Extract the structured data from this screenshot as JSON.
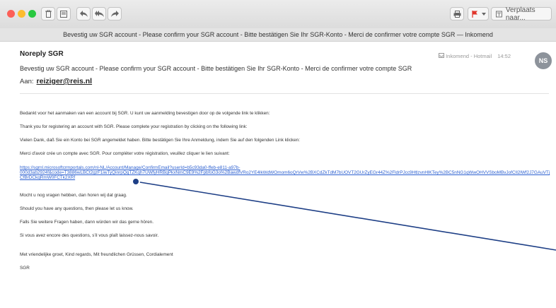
{
  "toolbar": {
    "move_label": "Verplaats naar...",
    "colors": {
      "close": "#fc5f57",
      "minimize": "#fdbc2e",
      "maximize": "#28c840",
      "flag": "#e0352b"
    }
  },
  "window_title": "Bevestig uw SGR account - Please confirm your SGR account - Bitte bestätigen Sie Ihr SGR-Konto - Merci de confirmer votre compte SGR — Inkomend",
  "message": {
    "sender": "Noreply SGR",
    "subject": "Bevestig uw SGR account - Please confirm your SGR account - Bitte bestätigen Sie Ihr SGR-Konto - Merci de confirmer votre compte SGR",
    "to_label": "Aan:",
    "to_address": "reiziger@reis.nl",
    "mailbox": "Inkomend - Hotmail",
    "time": "14:52",
    "avatar_initials": "NS",
    "body": {
      "intro_nl": "Bedankt voor het aanmaken van een account bij SGR. U kunt uw aanmelding bevestigen door op de volgende link te klikken:",
      "intro_en": "Thank you for registering an account with SGR. Please complete your registration by clicking on the following link:",
      "intro_de": "Vielen Dank, daß Sie ein Konto bei SGR angemeldet haben. Bitte bestätigen Sie Ihre Anmeldung, indem Sie auf den folgenden Link klicken:",
      "intro_fr": "Merci d'avoir crée un compte avec SGR. Pour compléter votre régistration, veuillez cliquer le lien suivant:",
      "link_line1": "https://sgrnl.microsoftcrmportals.com/nl-NL/Account/Manage/ConfirmEmail?userId=b5c93da0-ffeb-e811-a97b-",
      "link_line2": "000d3ab2924f&code=T3886wLBCt2gzF1iwTyQinrpQgTZKqh7UWfyHRBqPkxNmC9E9%2FpbfoG3o%2BawdfVRo2YE4lkWdWOmom6oQrVw%2BXCdZkTdM7bUOVT2GUrZyEGr44Z%2FldrPJcc9HtlzvnHlKTey%2BC5nNG1qWwOHVVSboMBvJofCIl2lWf2J7GAuVTj",
      "link_line3": "CfBrDCkqRmW0FCTk2XRf",
      "closing_nl": "Mocht u nog vragen hebben, dan horen wij dat graag.",
      "closing_en": "Should you have any questions, then please let us know.",
      "closing_de": "Falls Sie weitere Fragen haben, dann würden wir das gerne hören.",
      "closing_fr": "Si vous avez encore des questions, s'il vous plaît laissez-nous savoir.",
      "regards": "Met vriendelijke groet, Kind regards, Mit freundlichen Grüssen, Cordialement",
      "signature": "SGR"
    }
  },
  "annotation": {
    "marker_color": "#1e3f86",
    "arrow_color": "#1e3f86"
  }
}
